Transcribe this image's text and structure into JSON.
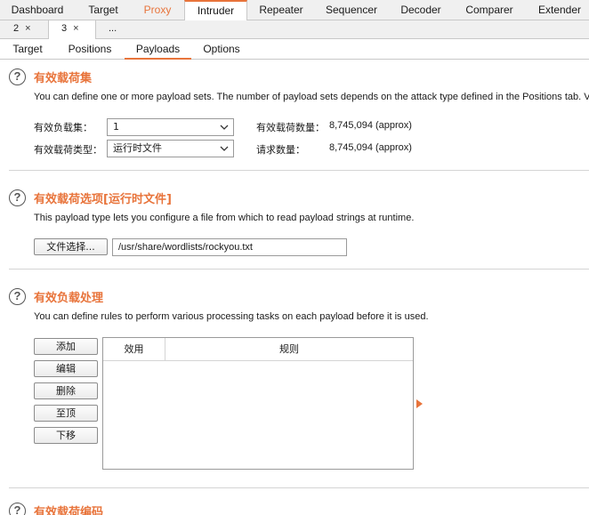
{
  "top_tabs": [
    "Dashboard",
    "Target",
    "Proxy",
    "Intruder",
    "Repeater",
    "Sequencer",
    "Decoder",
    "Comparer",
    "Extender"
  ],
  "attack_tabs": [
    {
      "label": "2",
      "close": "×"
    },
    {
      "label": "3",
      "close": "×"
    }
  ],
  "attack_tabs_more": "...",
  "intruder_tabs": [
    "Target",
    "Positions",
    "Payloads",
    "Options"
  ],
  "sets": {
    "help": "?",
    "title": "有效载荷集",
    "desc": "You can define one or more payload sets. The number of payload sets depends on the attack type defined in the Positions tab. Various",
    "payload_set_label": "有效负载集：",
    "payload_set_value": "1",
    "payload_type_label": "有效载荷类型：",
    "payload_type_value": "运行时文件",
    "payload_count_label": "有效载荷数量：",
    "payload_count_value": "8,745,094 (approx)",
    "request_count_label": "请求数量：",
    "request_count_value": "8,745,094 (approx)"
  },
  "options": {
    "help": "?",
    "title": "有效载荷选项[运行时文件]",
    "desc": "This payload type lets you configure a file from which to read payload strings at runtime.",
    "select_file_label": "文件选择...",
    "file_path": "/usr/share/wordlists/rockyou.txt"
  },
  "processing": {
    "help": "?",
    "title": "有效负载处理",
    "desc": "You can define rules to perform various processing tasks on each payload before it is used.",
    "buttons": [
      "添加",
      "编辑",
      "删除",
      "至顶",
      "下移"
    ],
    "columns": [
      "效用",
      "规则"
    ]
  },
  "encoding": {
    "help": "?",
    "title": "有效载荷编码"
  },
  "colors": {
    "accent": "#e8743b"
  }
}
